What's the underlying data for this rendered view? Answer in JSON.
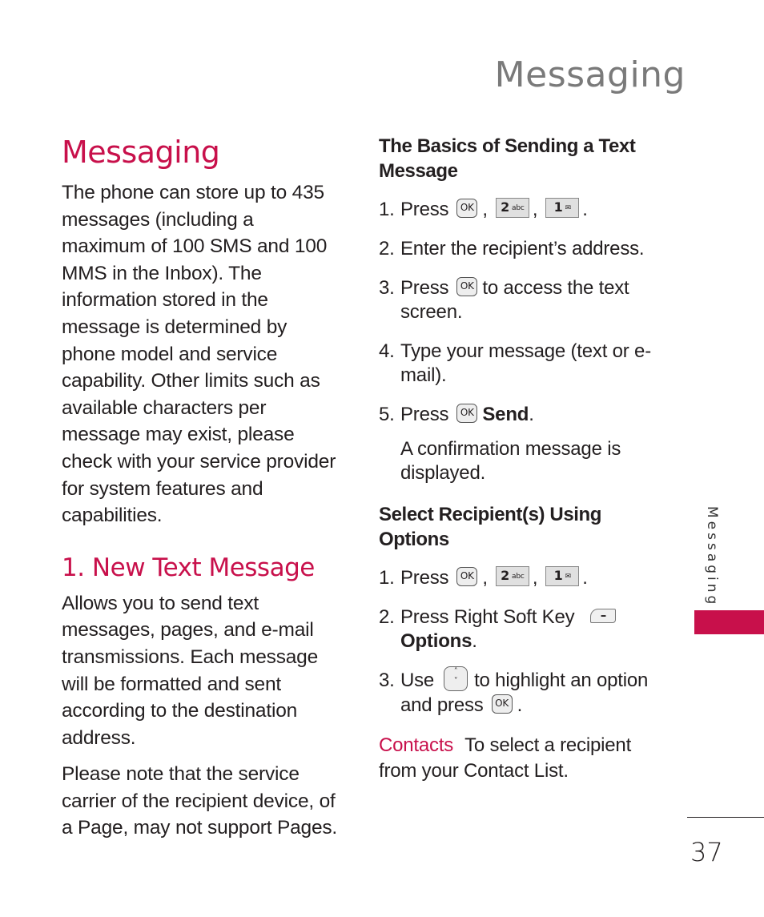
{
  "header": {
    "title": "Messaging"
  },
  "left_column": {
    "section_title": "Messaging",
    "intro": "The phone can store up to 435 messages (including a maximum of 100 SMS and 100 MMS in the Inbox). The information stored in the message is determined by phone model and service capability. Other limits such as available characters per message may exist, please check with your service provider for system features and capabilities.",
    "subsection_title": "1. New Text Message",
    "subsection_paragraphs": [
      "Allows you to send text messages, pages, and e-mail transmissions. Each message will be formatted and sent according to the destination address.",
      "Please note that the service carrier of the recipient device, of a Page, may not support Pages."
    ]
  },
  "right_column": {
    "basics": {
      "title": "The Basics of Sending a Text Message",
      "steps": [
        {
          "num": "1.",
          "pre": "Press",
          "sep1": ",",
          "sep2": ",",
          "end": "."
        },
        {
          "num": "2.",
          "text": "Enter the recipient’s address."
        },
        {
          "num": "3.",
          "pre": "Press",
          "post": "to access the text screen."
        },
        {
          "num": "4.",
          "text": "Type your message (text or e-mail)."
        },
        {
          "num": "5.",
          "pre": "Press",
          "bold": "Send",
          "end": "."
        }
      ],
      "note": "A confirmation message is displayed."
    },
    "select_recipient": {
      "title": "Select Recipient(s) Using Options",
      "steps": [
        {
          "num": "1.",
          "pre": "Press",
          "sep1": ",",
          "sep2": ",",
          "end": "."
        },
        {
          "num": "2.",
          "pre": "Press Right Soft Key",
          "bold": "Options",
          "end": "."
        },
        {
          "num": "3.",
          "pre": "Use",
          "mid": "to highlight an option and press",
          "end": "."
        }
      ],
      "contacts": {
        "label": "Contacts",
        "text": "To select a recipient from your Contact List."
      }
    }
  },
  "keys": {
    "ok": "OK",
    "two_main": "2",
    "two_sub": "abc",
    "one_main": "1",
    "one_sub": "✉",
    "nav_up": "˄",
    "nav_down": "˅",
    "soft": "–"
  },
  "side_tab": {
    "label": "Messaging",
    "color": "#c8104b"
  },
  "footer": {
    "page_number": "37"
  },
  "colors": {
    "accent": "#c8104b",
    "header_gray": "#7a7a7a",
    "text": "#231f20"
  }
}
